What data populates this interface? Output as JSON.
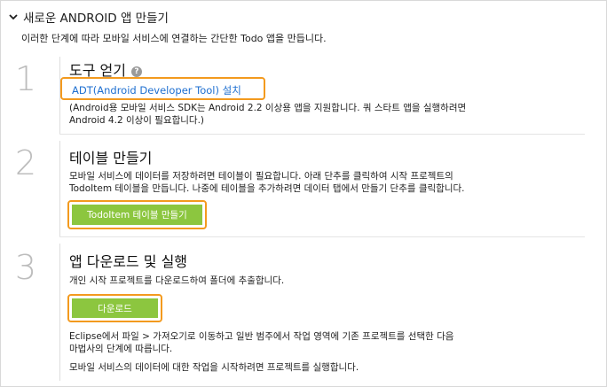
{
  "header": {
    "title": "새로운 ANDROID 앱 만들기",
    "chevron_icon": "chevron-down-icon"
  },
  "intro": "이러한 단계에 따라 모바일 서비스에 연결하는 간단한 Todo 앱을 만듭니다.",
  "steps": [
    {
      "number": "1",
      "title": "도구 얻기",
      "help_icon": "question-icon",
      "link": "ADT(Android Developer Tool) 설치",
      "desc_lines": [
        "(Android용 모바일 서비스 SDK는 Android 2.2 이상용 앱을 지원합니다. 쿼 스타트 앱을 실행하려면",
        "Android 4.2 이상이 필요합니다.)"
      ]
    },
    {
      "number": "2",
      "title": "테이블 만들기",
      "desc_lines": [
        "모바일 서비스에 데이터를 저장하려면 테이블이 필요합니다. 아래 단추를 클릭하여 시작 프로젝트의",
        "TodoItem 테이블을 만듭니다. 나중에 테이블을 추가하려면 데이터 탭에서 만들기 단추를 클릭합니다."
      ],
      "button": "TodoItem 테이블 만들기"
    },
    {
      "number": "3",
      "title": "앱 다운로드 및 실행",
      "desc_lines": [
        "개인 시작 프로젝트를 다운로드하여 폴더에 추출합니다."
      ],
      "button": "다운로드",
      "after_lines": [
        "Eclipse에서 파일 > 가져오기로 이동하고 일반 범주에서 작업 영역에 기존 프로젝트를 선택한 다음",
        "마법사의 단계에 따릅니다."
      ],
      "final_line": "모바일 서비스의 데이터에 대한 작업을 시작하려면 프로젝트를 실행합니다."
    }
  ],
  "colors": {
    "highlight": "#f39a1e",
    "button": "#8cc63f",
    "link": "#1e6fd0"
  }
}
